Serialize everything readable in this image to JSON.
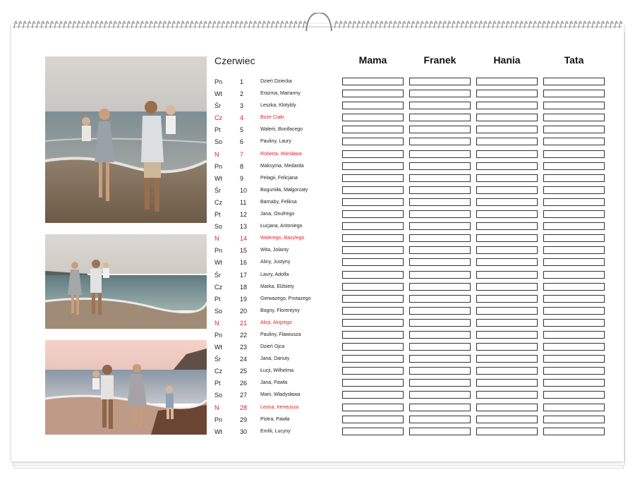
{
  "month": "Czerwiec",
  "columns": [
    "Mama",
    "Franek",
    "Hania",
    "Tata"
  ],
  "days": [
    {
      "day": "Pn",
      "num": "1",
      "names": "Dzień Dziecka",
      "holiday": false
    },
    {
      "day": "Wt",
      "num": "2",
      "names": "Erazma, Marianny",
      "holiday": false
    },
    {
      "day": "Śr",
      "num": "3",
      "names": "Leszka, Klotyldy",
      "holiday": false
    },
    {
      "day": "Cz",
      "num": "4",
      "names": "Boże Ciało",
      "holiday": true
    },
    {
      "day": "Pt",
      "num": "5",
      "names": "Walerii, Bonifacego",
      "holiday": false
    },
    {
      "day": "So",
      "num": "6",
      "names": "Pauliny, Laury",
      "holiday": false
    },
    {
      "day": "N",
      "num": "7",
      "names": "Roberta, Wiesława",
      "holiday": true
    },
    {
      "day": "Pn",
      "num": "8",
      "names": "Maksyma, Medarda",
      "holiday": false
    },
    {
      "day": "Wt",
      "num": "9",
      "names": "Pelagii, Felicjana",
      "holiday": false
    },
    {
      "day": "Śr",
      "num": "10",
      "names": "Bogumiła, Małgorzaty",
      "holiday": false
    },
    {
      "day": "Cz",
      "num": "11",
      "names": "Barnaby, Feliksa",
      "holiday": false
    },
    {
      "day": "Pt",
      "num": "12",
      "names": "Jana, Onufrego",
      "holiday": false
    },
    {
      "day": "So",
      "num": "13",
      "names": "Łucjana, Antoniego",
      "holiday": false
    },
    {
      "day": "N",
      "num": "14",
      "names": "Walerego, Bazylego",
      "holiday": true
    },
    {
      "day": "Pn",
      "num": "15",
      "names": "Wita, Jolanty",
      "holiday": false
    },
    {
      "day": "Wt",
      "num": "16",
      "names": "Aliny, Justyny",
      "holiday": false
    },
    {
      "day": "Śr",
      "num": "17",
      "names": "Laury, Adolfa",
      "holiday": false
    },
    {
      "day": "Cz",
      "num": "18",
      "names": "Marka, Elżbiety",
      "holiday": false
    },
    {
      "day": "Pt",
      "num": "19",
      "names": "Gerwazego, Protazego",
      "holiday": false
    },
    {
      "day": "So",
      "num": "20",
      "names": "Bogny, Florentyny",
      "holiday": false
    },
    {
      "day": "N",
      "num": "21",
      "names": "Alicji, Alojzego",
      "holiday": true
    },
    {
      "day": "Pn",
      "num": "22",
      "names": "Pauliny, Flawiusza",
      "holiday": false
    },
    {
      "day": "Wt",
      "num": "23",
      "names": "Dzień Ojca",
      "holiday": false
    },
    {
      "day": "Śr",
      "num": "24",
      "names": "Jana, Danuty",
      "holiday": false
    },
    {
      "day": "Cz",
      "num": "25",
      "names": "Łucji, Wilhelma",
      "holiday": false
    },
    {
      "day": "Pt",
      "num": "26",
      "names": "Jana, Pawła",
      "holiday": false
    },
    {
      "day": "So",
      "num": "27",
      "names": "Marii, Władysława",
      "holiday": false
    },
    {
      "day": "N",
      "num": "28",
      "names": "Leona, Ireneusza",
      "holiday": true
    },
    {
      "day": "Pn",
      "num": "29",
      "names": "Piotra, Pawła",
      "holiday": false
    },
    {
      "day": "Wt",
      "num": "30",
      "names": "Emilii, Lucyny",
      "holiday": false
    }
  ],
  "colors": {
    "holiday": "#e3202a",
    "text": "#222222"
  },
  "photos": [
    "family-beach-photo-1",
    "family-beach-photo-2",
    "family-beach-photo-3"
  ]
}
